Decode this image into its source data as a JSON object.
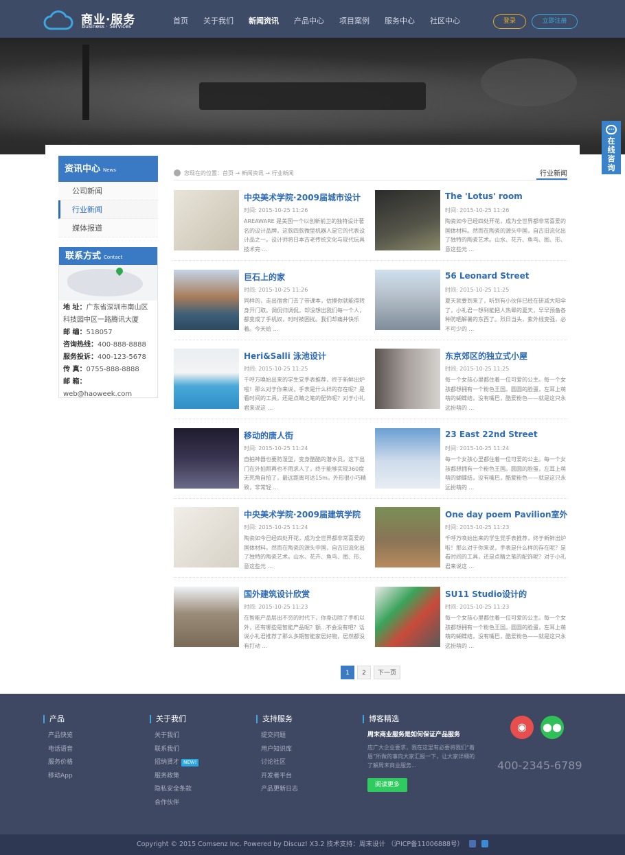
{
  "header": {
    "logo_name": "商业·服务",
    "logo_sub": "Business · Services",
    "nav": [
      "首页",
      "关于我们",
      "新闻资讯",
      "产品中心",
      "项目案例",
      "服务中心",
      "社区中心"
    ],
    "active_nav": "新闻资讯",
    "login": "登录",
    "register": "立即注册"
  },
  "float_service": "在线咨询",
  "sidebar": {
    "news_title": "资讯中心",
    "news_sub": "News",
    "news_items": [
      "公司新闻",
      "行业新闻",
      "媒体报道"
    ],
    "active_item": "行业新闻",
    "contact_title": "联系方式",
    "contact_sub": "Contact",
    "contact": {
      "address_label": "地 址：",
      "address": "广东省深圳市南山区科技园中区一路腾讯大厦",
      "zip_label": "邮 编：",
      "zip": "518057",
      "hotline_label": "咨询热线：",
      "hotline": "400-888-8888",
      "complaint_label": "服务投诉：",
      "complaint": "400-123-5678",
      "fax_label": "传 真：",
      "fax": "0755-888-8888",
      "email_label": "邮 箱：",
      "email": "web@haoweek.com"
    }
  },
  "breadcrumb": "您现在的位置：首页 → 新闻资讯 → 行业新闻",
  "category_title": "行业新闻",
  "articles": [
    {
      "title": "中央美术学院·2009届城市设计",
      "date": "时间: 2015-10-25 11:26",
      "excerpt": "AREAWARE 是美国一个以创新前卫的独特设计著名的设计品牌，这款四款微型机器人是它的代表设计品之一。设计师将日本古老传统文化与现代玩具技术完 ..."
    },
    {
      "title": "The 'Lotus' room",
      "date": "时间: 2015-10-25 11:26",
      "excerpt": "陶瓷如今已经四处开花，成为全世界都非常喜爱的国体材料。然而在陶瓷的源头中国，自古旧流化出了独特的陶瓷艺术。山水、花卉、鱼鸟、图、形、意这些元 ..."
    },
    {
      "title": "巨石上的家",
      "date": "时间: 2015-10-25 11:26",
      "excerpt": "同样的，走出宿舍门去了带课本，估摸你就能得转身开门取。调侃归调侃，却没想出我们每一个人，都变成了手机奴，时时被困扰。我们却痛并快乐着。今天给 ..."
    },
    {
      "title": "56 Leonard Street",
      "date": "时间: 2015-10-25 11:25",
      "excerpt": "夏天就要到来了，听到有小伙伴已经在研减大阳伞了，小礼君一想到能把人热晕的夏天，早早预备各种防晒解暑的东西了。烈日当头，紫外线变强，必不可少的 ..."
    },
    {
      "title": "Heri&Salli 泳池设计",
      "date": "时间: 2015-10-25 11:25",
      "excerpt": "千呼万唤始出来的学生党手表推荐，终于新鲜出炉啦！那么对于你来说，手表是什么样的存在呢？是看时间的工具，还是点睛之笔的配饰呢？对于小礼君来说这 ..."
    },
    {
      "title": "东京郊区的独立式小屋",
      "date": "时间: 2015-10-25 11:25",
      "excerpt": "每一个女孩心里都住着一位可爱的公主。每一个女孩都想拥有一个粉色王国。圆圆的脸蛋，左耳上萌萌的蝴蝶结，没有嘴巴，酷爱粉色——就是这只永远扮萌的 ..."
    },
    {
      "title": "移动的唐人街",
      "date": "时间: 2015-10-25 11:24",
      "excerpt": "自拍神器也要防湿型，变身酷酷的潜水员。这下出门在外拍照再也不用求人了，终于能够实现360度无死角自拍了，最远距离可达15m。外形很小巧精致，非常轻 ..."
    },
    {
      "title": "23 East 22nd Street",
      "date": "时间: 2015-10-25 11:24",
      "excerpt": "每一个女孩心里都住着一位可爱的公主。每一个女孩都想拥有一个粉色王国。圆圆的脸蛋，左耳上萌萌的蝴蝶结，没有嘴巴，酷爱粉色——就是这只永远扮萌的 ..."
    },
    {
      "title": "中央美术学院·2009届建筑学院",
      "date": "时间: 2015-10-25 11:24",
      "excerpt": "陶瓷如今已经四处开花，成为全世界都非常喜爱的国体材料。然而在陶瓷的源头中国，自古旧流化出了独特的陶瓷艺术。山水、花卉、鱼鸟、图、形、意这些元 ..."
    },
    {
      "title": "One day poem Pavilion室外",
      "date": "时间: 2015-10-25 11:23",
      "excerpt": "千呼万唤始出来的学生党手表推荐，终于新鲜出炉啦！那么对于你来说，手表是什么样的存在呢？是看时间的工具，还是点睛之笔的配饰呢？对于小礼君来说这 ..."
    },
    {
      "title": "国外建筑设计欣赏",
      "date": "时间: 2015-10-25 11:23",
      "excerpt": "在智能产品层出不穷的时代下，你身边除了手机以外，还有哪些是智能产品呢？额...不会没有吧？话说小礼君推荐了那么多期智能家居好物，居然都没有打动 ..."
    },
    {
      "title": "SU11 Studio设计的",
      "date": "时间: 2015-10-25 11:23",
      "excerpt": "每一个女孩心里都住着一位可爱的公主。每一个女孩都想拥有一个粉色王国。圆圆的脸蛋，左耳上萌萌的蝴蝶结，没有嘴巴，酷爱粉色——就是这只永远扮萌的 ..."
    }
  ],
  "pager": {
    "pages": [
      "1",
      "2"
    ],
    "current": "1",
    "next": "下一页"
  },
  "footer": {
    "col1": {
      "title": "产品",
      "links": [
        "产品快览",
        "电话语音",
        "服务价格",
        "移动App"
      ]
    },
    "col2": {
      "title": "关于我们",
      "links": [
        "关于我们",
        "联系我们",
        "招纳贤才",
        "服务政策",
        "隐私安全条款",
        "合作伙伴"
      ],
      "new_badge": "NEW!"
    },
    "col3": {
      "title": "支持服务",
      "links": [
        "提交问题",
        "用户知识库",
        "讨论社区",
        "开发者平台",
        "产品更新日志"
      ]
    },
    "blog": {
      "title": "博客精选",
      "headline": "周末商业服务是如何保证产品服务",
      "text": "应广大企业要求，我在这里有必要将我们“着眉”所做的事向大家汇报一下，让大家详细的了解周末商业服务...",
      "button": "阅读更多"
    },
    "phone": "400-2345-6789"
  },
  "copyright": "Copyright © 2015  Comsenz Inc.  Powered by  Discuz!  X3.2  技术支持：周末设计  （沪ICP备11006888号）"
}
